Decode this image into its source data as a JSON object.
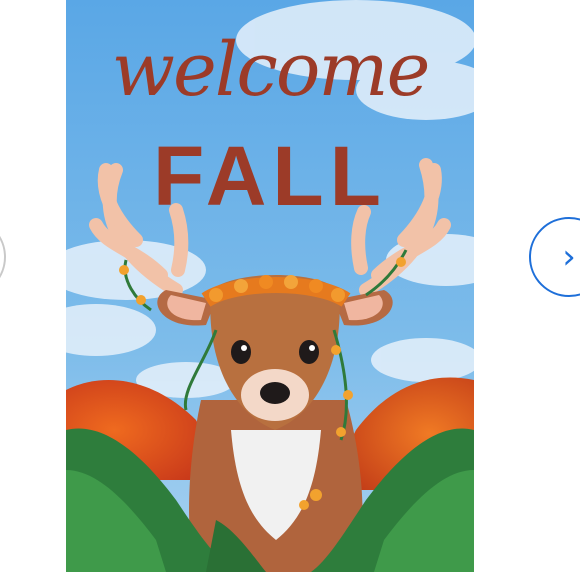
{
  "carousel": {
    "prev_icon": "chevron-left-icon",
    "next_icon": "chevron-right-icon",
    "prev_glyph": "‹",
    "next_glyph": "›",
    "accent_color": "#1e6fd9"
  },
  "product_image": {
    "flag_text_script": "welcome",
    "flag_text_block": "FALL",
    "text_color": "#9c3b28"
  }
}
